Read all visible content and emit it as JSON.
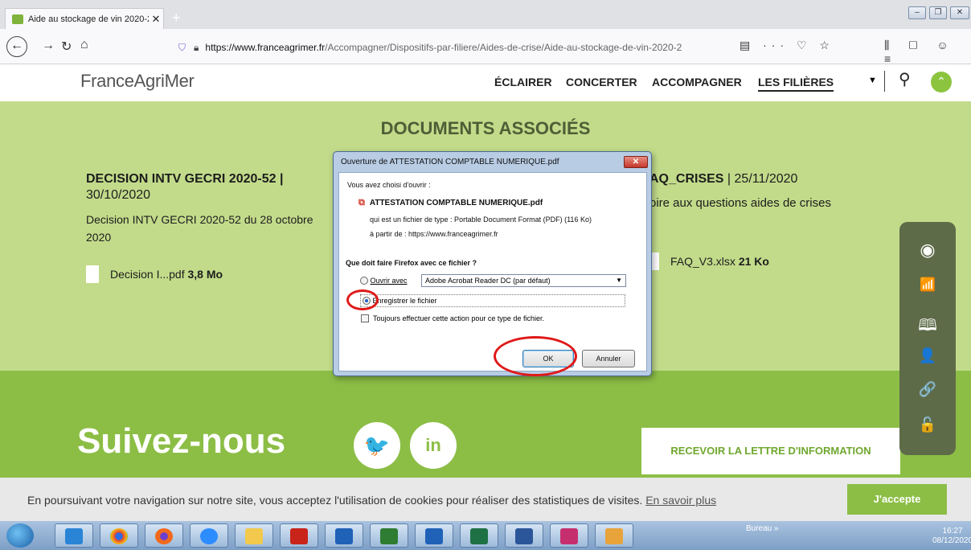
{
  "browser": {
    "tab_title": "Aide au stockage de vin 2020-2",
    "tab_close": "✕",
    "new_tab": "+",
    "url_host": "https://www.franceagrimer.fr",
    "url_path": "/Accompagner/Dispositifs-par-filiere/Aides-de-crise/Aide-au-stockage-de-vin-2020-2",
    "url_actions": "▤ ··· ♡ ☆",
    "toolbar_icons": "⫼ ▢ ☺ ≡",
    "window_min": "–",
    "window_max": "❐",
    "window_close": "✕"
  },
  "site": {
    "logo": "FranceAgriMer",
    "menu": [
      "ÉCLAIRER",
      "CONCERTER",
      "ACCOMPAGNER",
      "LES FILIÈRES"
    ],
    "menu_dropdown": "▼"
  },
  "documents": {
    "heading": "DOCUMENTS ASSOCIÉS",
    "doc1": {
      "title": "DECISION INTV GECRI 2020-52 |",
      "date": "30/10/2020",
      "description": "Decision INTV GECRI 2020-52 du 28 octobre 2020",
      "file_name": "Decision I...pdf",
      "file_size": "3,8 Mo"
    },
    "doc2": {
      "title": "AQ_CRISES",
      "title_sep": " | ",
      "date": "25/11/2020",
      "description": "oire aux questions aides de crises",
      "file_name": "FAQ_V3.xlsx",
      "file_size": "21 Ko"
    }
  },
  "follow": {
    "label": "Suivez-nous",
    "twitter": "🐦",
    "linkedin": "in",
    "newsletter": "RECEVOIR LA LETTRE D'INFORMATION"
  },
  "side_tools": {
    "icons": [
      "eye-icon",
      "chart-icon",
      "book-icon",
      "user-icon",
      "link-icon",
      "lock-icon"
    ],
    "glyphs": [
      "◉",
      "📶",
      "🕮",
      "👤",
      "🔗",
      "🔓"
    ]
  },
  "cookie": {
    "text": "En poursuivant votre navigation sur notre site, vous acceptez l'utilisation de cookies pour réaliser des statistiques de visites.",
    "link": "En savoir plus",
    "accept": "J'accepte"
  },
  "dialog": {
    "title": "Ouverture de ATTESTATION COMPTABLE NUMERIQUE.pdf",
    "close": "✕",
    "chosen": "Vous avez choisi d'ouvrir :",
    "file_name": "ATTESTATION COMPTABLE NUMERIQUE.pdf",
    "file_type": "qui est un fichier de type : Portable Document Format (PDF) (116 Ko)",
    "source": "à partir de : https://www.franceagrimer.fr",
    "question": "Que doit faire Firefox avec ce fichier ?",
    "open_with": "Ouvrir avec",
    "open_app": "Adobe Acrobat Reader DC  (par défaut)",
    "save_file": "Enregistrer le fichier",
    "always": "Toujours effectuer cette action pour ce type de fichier.",
    "ok": "OK",
    "cancel": "Annuler",
    "selected_option": "save"
  },
  "taskbar": {
    "tray_label": "Bureau",
    "tray_chevron": "»",
    "time": "16:27",
    "date": "08/12/2020"
  },
  "colors": {
    "green_light": "#c2db8a",
    "green_dark": "#8cbe46",
    "annotation_red": "#e01919"
  }
}
